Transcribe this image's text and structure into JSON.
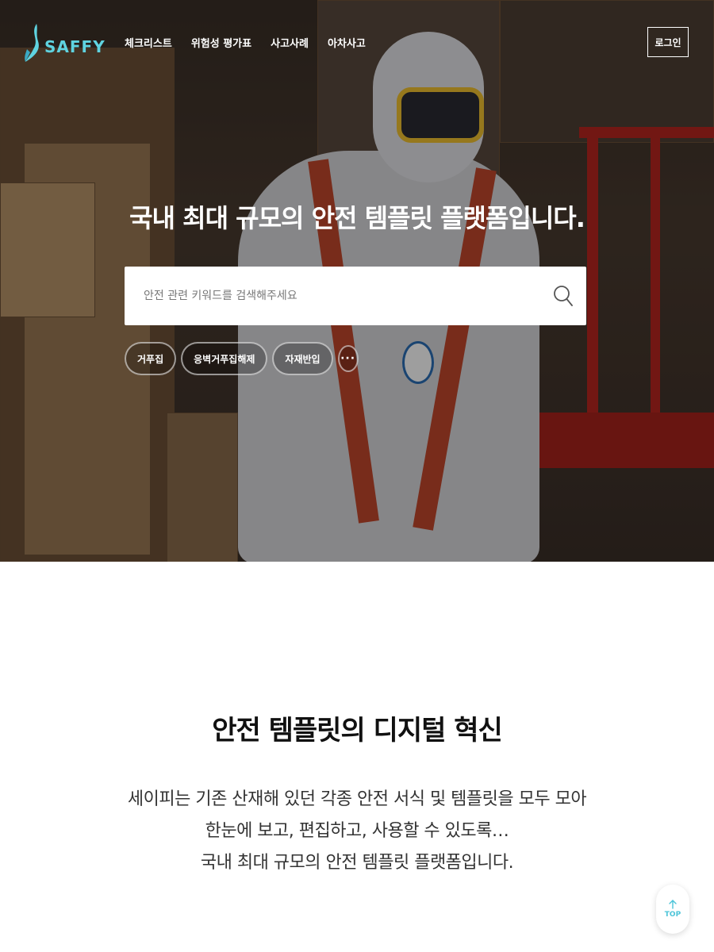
{
  "brand": {
    "name": "SAFFY",
    "accent": "#5fd3e0"
  },
  "nav": {
    "items": [
      "체크리스트",
      "위험성 평가표",
      "사고사례",
      "아차사고"
    ]
  },
  "auth": {
    "login_label": "로그인"
  },
  "hero": {
    "title": "국내 최대 규모의 안전 템플릿 플랫폼입니다.",
    "search_placeholder": "안전 관련 키워드를 검색해주세요",
    "tags": [
      "거푸집",
      "응벽거푸집해제",
      "자재반입"
    ],
    "more_label": "···"
  },
  "intro": {
    "title": "안전 템플릿의 디지털 혁신",
    "lines": [
      "세이피는 기존 산재해 있던 각종 안전 서식 및 템플릿을 모두 모아",
      "한눈에 보고, 편집하고, 사용할 수 있도록…",
      "국내 최대 규모의 안전 템플릿 플랫폼입니다."
    ]
  },
  "scroll_top": {
    "label": "TOP"
  },
  "icons": [
    "search-icon",
    "arrow-up-icon",
    "saffy-logo-mark",
    "more-icon"
  ]
}
